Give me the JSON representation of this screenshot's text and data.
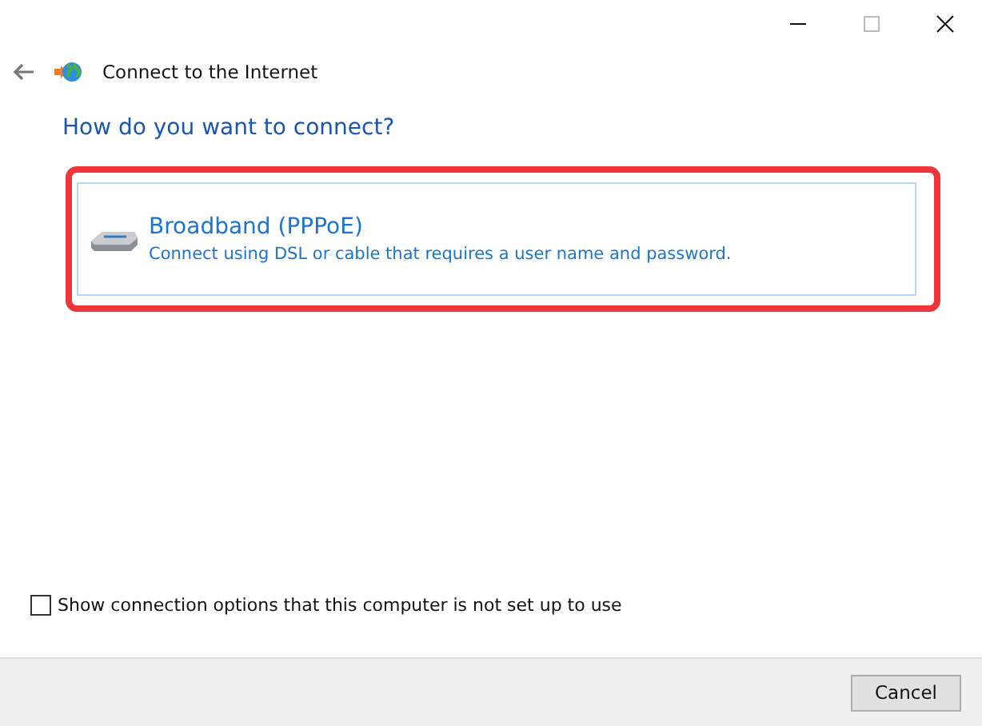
{
  "window": {
    "title": "Connect to the Internet"
  },
  "heading": "How do you want to connect?",
  "options": [
    {
      "title": "Broadband (PPPoE)",
      "description": "Connect using DSL or cable that requires a user name and password.",
      "highlighted": true
    }
  ],
  "show_options_checkbox": {
    "label": "Show connection options that this computer is not set up to use",
    "checked": false
  },
  "buttons": [
    "Cancel"
  ]
}
